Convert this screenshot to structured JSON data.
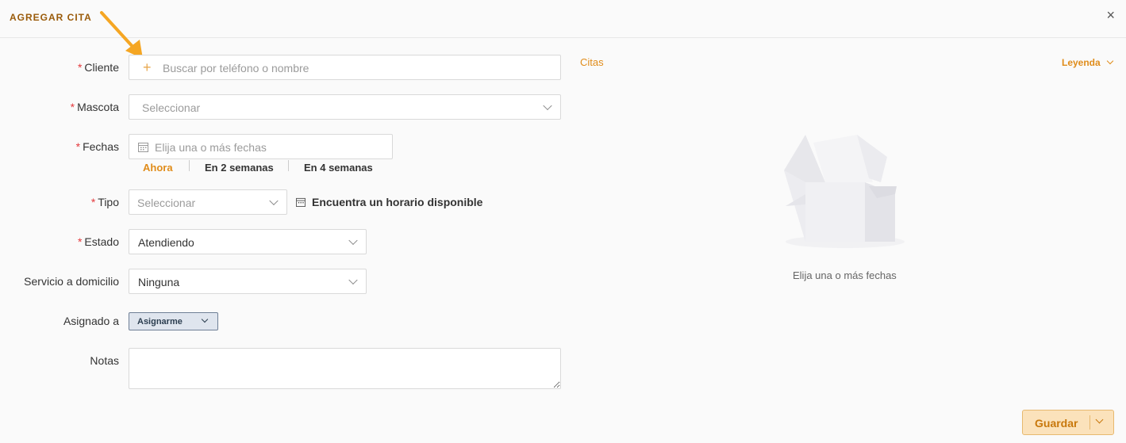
{
  "header": {
    "title": "AGREGAR CITA",
    "close_icon": "×"
  },
  "form": {
    "cliente": {
      "label": "Cliente",
      "placeholder": "Buscar por teléfono o nombre"
    },
    "mascota": {
      "label": "Mascota",
      "placeholder": "Seleccionar"
    },
    "fechas": {
      "label": "Fechas",
      "placeholder": "Elija una o más fechas",
      "quick": [
        "Ahora",
        "En 2 semanas",
        "En 4 semanas"
      ]
    },
    "tipo": {
      "label": "Tipo",
      "placeholder": "Seleccionar",
      "find_slot": "Encuentra un horario disponible"
    },
    "estado": {
      "label": "Estado",
      "value": "Atendiendo"
    },
    "servicio": {
      "label": "Servicio a domicilio",
      "value": "Ninguna"
    },
    "asignado": {
      "label": "Asignado a",
      "value": "Asignarme"
    },
    "notas": {
      "label": "Notas",
      "value": ""
    },
    "required_mark": "*"
  },
  "right_panel": {
    "citas_link": "Citas",
    "legend_link": "Leyenda",
    "empty_text": "Elija una o más fechas"
  },
  "footer": {
    "save_label": "Guardar"
  },
  "colors": {
    "accent": "#e08c1a",
    "title": "#9a5b0a",
    "required": "#e4393c"
  },
  "icons": [
    "close-icon",
    "plus-icon",
    "calendar-icon",
    "chevron-down-icon",
    "empty-box-icon",
    "annotation-arrow-icon"
  ]
}
